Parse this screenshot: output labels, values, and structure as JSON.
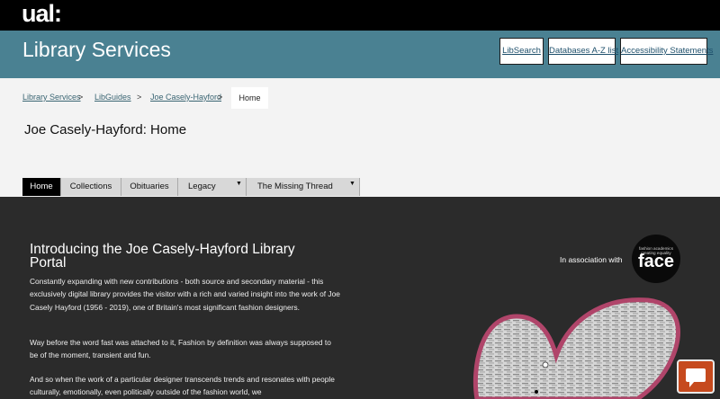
{
  "brand": {
    "logo_text": "ual:"
  },
  "header": {
    "title": "Library Services",
    "buttons": [
      "LibSearch",
      "Databases A-Z list",
      "Accessibility Statements"
    ]
  },
  "breadcrumb": {
    "links": [
      "Library Services",
      "LibGuides",
      "Joe Casely-Hayford"
    ],
    "separator": ">",
    "current": "Home"
  },
  "page": {
    "title": "Joe Casely-Hayford: Home"
  },
  "tabs": [
    {
      "label": "Home",
      "active": true
    },
    {
      "label": "Collections"
    },
    {
      "label": "Obituaries"
    },
    {
      "label": "Legacy",
      "has_menu": true
    },
    {
      "label": "The Missing Thread",
      "has_menu": true
    }
  ],
  "content": {
    "heading": "Introducing the Joe Casely-Hayford Library Portal",
    "paragraphs": [
      "Constantly expanding with new contributions - both source and secondary material - this exclusively digital library provides the visitor with a rich and varied insight into the work of Joe Casely Hayford (1956 - 2019), one of Britain's most significant fashion designers.",
      "Way before the word fast was attached to it, Fashion by definition was always supposed to be of the moment, transient and fun.",
      "And so when the work of a particular designer transcends trends and resonates with people culturally, emotionally, even politically outside of the fashion world, we"
    ]
  },
  "association": {
    "label": "In association with",
    "logo_small_text": "fashion academics creating equality",
    "logo_word": "face"
  },
  "icons": {
    "tab_menu": "caret-down-icon",
    "chat": "chat-bubble-icon"
  },
  "colors": {
    "header_bar": "#000000",
    "banner": "#4a8192",
    "crumb_area": "#f3f3f3",
    "content_bg": "#2b2b2b",
    "chat_button": "#c64a1e",
    "heart_outline": "#b0456a"
  }
}
